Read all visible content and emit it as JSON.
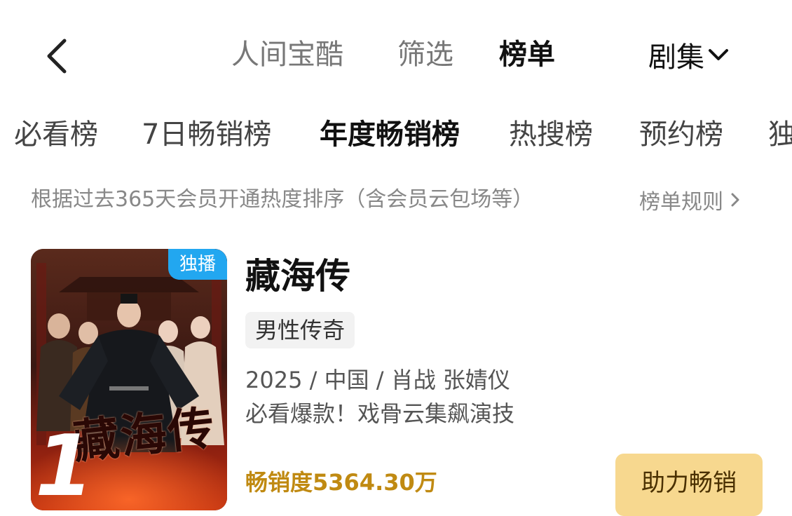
{
  "nav": {
    "tabs": [
      {
        "label": "人间宝酷",
        "active": false
      },
      {
        "label": "筛选",
        "active": false
      },
      {
        "label": "榜单",
        "active": true
      }
    ],
    "category": "剧集",
    "icons": {
      "back": "chevron-left-icon",
      "dropdown": "chevron-down-icon"
    }
  },
  "rank_tabs": [
    {
      "label": "必看榜",
      "active": false
    },
    {
      "label": "7日畅销榜",
      "active": false
    },
    {
      "label": "年度畅销榜",
      "active": true
    },
    {
      "label": "热搜榜",
      "active": false
    },
    {
      "label": "预约榜",
      "active": false
    },
    {
      "label": "独",
      "active": false
    }
  ],
  "description": "根据过去365天会员开通热度排序（含会员云包场等）",
  "rules_link": "榜单规则",
  "items": [
    {
      "rank": "1",
      "badge": "独播",
      "poster_title": "藏海传",
      "title": "藏海传",
      "genre": "男性传奇",
      "meta": "2025 / 中国 / 肖战 张婧仪",
      "slogan": "必看爆款！戏骨云集飙演技",
      "sales": "畅销度5364.30万",
      "button": "助力畅销"
    }
  ],
  "colors": {
    "accent_gold": "#c08a12",
    "button_bg": "#f7d88f",
    "badge_blue": "#22a7f0"
  }
}
